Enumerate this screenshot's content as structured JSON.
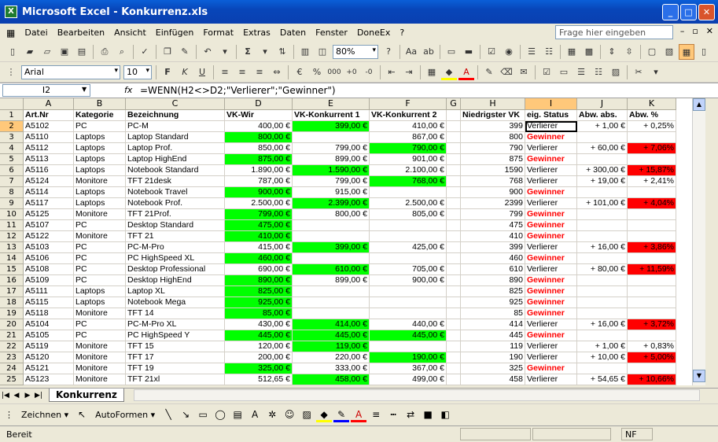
{
  "window": {
    "title": "Microsoft Excel - Konkurrenz.xls"
  },
  "menu": [
    "Datei",
    "Bearbeiten",
    "Ansicht",
    "Einfügen",
    "Format",
    "Extras",
    "Daten",
    "Fenster",
    "DoneEx",
    "?"
  ],
  "help_placeholder": "Frage hier eingeben",
  "toolbar": {
    "zoom": "80%",
    "font": "Arial",
    "size": "10",
    "bold": "F",
    "italic": "K",
    "underline": "U",
    "percent": "%",
    "thousands": "000"
  },
  "formula_bar": {
    "name_box": "I2",
    "fx": "fx",
    "formula": "=WENN(H2<>D2;\"Verlierer\";\"Gewinner\")"
  },
  "columns": [
    "A",
    "B",
    "C",
    "D",
    "E",
    "F",
    "G",
    "H",
    "I",
    "J",
    "K"
  ],
  "selected_column": "I",
  "header_row": [
    "Art.Nr",
    "Kategorie",
    "Bezeichnung",
    "VK-Wir",
    "VK-Konkurrent 1",
    "VK-Konkurrent 2",
    "",
    "Niedrigster VK",
    "eig. Status",
    "Abw. abs.",
    "Abw. %"
  ],
  "rows": [
    [
      "A5102",
      "PC",
      "PC-M",
      "400,00 €",
      "399,00 €",
      "410,00 €",
      "",
      "399",
      "Verlierer",
      "+ 1,00 €",
      "+ 0,25%"
    ],
    [
      "A5110",
      "Laptops",
      "Laptop Standard",
      "800,00 €",
      "",
      "867,00 €",
      "",
      "800",
      "Gewinner",
      "",
      ""
    ],
    [
      "A5112",
      "Laptops",
      "Laptop Prof.",
      "850,00 €",
      "799,00 €",
      "790,00 €",
      "",
      "790",
      "Verlierer",
      "+ 60,00 €",
      "+ 7,06%"
    ],
    [
      "A5113",
      "Laptops",
      "Laptop HighEnd",
      "875,00 €",
      "899,00 €",
      "901,00 €",
      "",
      "875",
      "Gewinner",
      "",
      ""
    ],
    [
      "A5116",
      "Laptops",
      "Notebook Standard",
      "1.890,00 €",
      "1.590,00 €",
      "2.100,00 €",
      "",
      "1590",
      "Verlierer",
      "+ 300,00 €",
      "+ 15,87%"
    ],
    [
      "A5124",
      "Monitore",
      "TFT 21desk",
      "787,00 €",
      "799,00 €",
      "768,00 €",
      "",
      "768",
      "Verlierer",
      "+ 19,00 €",
      "+ 2,41%"
    ],
    [
      "A5114",
      "Laptops",
      "Notebook Travel",
      "900,00 €",
      "915,00 €",
      "",
      "",
      "900",
      "Gewinner",
      "",
      ""
    ],
    [
      "A5117",
      "Laptops",
      "Notebook Prof.",
      "2.500,00 €",
      "2.399,00 €",
      "2.500,00 €",
      "",
      "2399",
      "Verlierer",
      "+ 101,00 €",
      "+ 4,04%"
    ],
    [
      "A5125",
      "Monitore",
      "TFT 21Prof.",
      "799,00 €",
      "800,00 €",
      "805,00 €",
      "",
      "799",
      "Gewinner",
      "",
      ""
    ],
    [
      "A5107",
      "PC",
      "Desktop Standard",
      "475,00 €",
      "",
      "",
      "",
      "475",
      "Gewinner",
      "",
      ""
    ],
    [
      "A5122",
      "Monitore",
      "TFT 21",
      "410,00 €",
      "",
      "",
      "",
      "410",
      "Gewinner",
      "",
      ""
    ],
    [
      "A5103",
      "PC",
      "PC-M-Pro",
      "415,00 €",
      "399,00 €",
      "425,00 €",
      "",
      "399",
      "Verlierer",
      "+ 16,00 €",
      "+ 3,86%"
    ],
    [
      "A5106",
      "PC",
      "PC HighSpeed XL",
      "460,00 €",
      "",
      "",
      "",
      "460",
      "Gewinner",
      "",
      ""
    ],
    [
      "A5108",
      "PC",
      "Desktop Professional",
      "690,00 €",
      "610,00 €",
      "705,00 €",
      "",
      "610",
      "Verlierer",
      "+ 80,00 €",
      "+ 11,59%"
    ],
    [
      "A5109",
      "PC",
      "Desktop HighEnd",
      "890,00 €",
      "899,00 €",
      "900,00 €",
      "",
      "890",
      "Gewinner",
      "",
      ""
    ],
    [
      "A5111",
      "Laptops",
      "Laptop XL",
      "825,00 €",
      "",
      "",
      "",
      "825",
      "Gewinner",
      "",
      ""
    ],
    [
      "A5115",
      "Laptops",
      "Notebook Mega",
      "925,00 €",
      "",
      "",
      "",
      "925",
      "Gewinner",
      "",
      ""
    ],
    [
      "A5118",
      "Monitore",
      "TFT 14",
      "85,00 €",
      "",
      "",
      "",
      "85",
      "Gewinner",
      "",
      ""
    ],
    [
      "A5104",
      "PC",
      "PC-M-Pro XL",
      "430,00 €",
      "414,00 €",
      "440,00 €",
      "",
      "414",
      "Verlierer",
      "+ 16,00 €",
      "+ 3,72%"
    ],
    [
      "A5105",
      "PC",
      "PC HighSpeed Y",
      "445,00 €",
      "445,00 €",
      "445,00 €",
      "",
      "445",
      "Gewinner",
      "",
      ""
    ],
    [
      "A5119",
      "Monitore",
      "TFT 15",
      "120,00 €",
      "119,00 €",
      "",
      "",
      "119",
      "Verlierer",
      "+ 1,00 €",
      "+ 0,83%"
    ],
    [
      "A5120",
      "Monitore",
      "TFT 17",
      "200,00 €",
      "220,00 €",
      "190,00 €",
      "",
      "190",
      "Verlierer",
      "+ 10,00 €",
      "+ 5,00%"
    ],
    [
      "A5121",
      "Monitore",
      "TFT 19",
      "325,00 €",
      "333,00 €",
      "367,00 €",
      "",
      "325",
      "Gewinner",
      "",
      ""
    ],
    [
      "A5123",
      "Monitore",
      "TFT 21xl",
      "512,65 €",
      "458,00 €",
      "499,00 €",
      "",
      "458",
      "Verlierer",
      "+ 54,65 €",
      "+ 10,66%"
    ]
  ],
  "green_cells": [
    [
      0,
      4
    ],
    [
      1,
      3
    ],
    [
      2,
      5
    ],
    [
      3,
      3
    ],
    [
      4,
      4
    ],
    [
      5,
      5
    ],
    [
      6,
      3
    ],
    [
      7,
      4
    ],
    [
      8,
      3
    ],
    [
      9,
      3
    ],
    [
      10,
      3
    ],
    [
      11,
      4
    ],
    [
      12,
      3
    ],
    [
      13,
      4
    ],
    [
      14,
      3
    ],
    [
      15,
      3
    ],
    [
      16,
      3
    ],
    [
      17,
      3
    ],
    [
      18,
      4
    ],
    [
      19,
      3
    ],
    [
      19,
      4
    ],
    [
      19,
      5
    ],
    [
      20,
      4
    ],
    [
      21,
      5
    ],
    [
      22,
      3
    ],
    [
      23,
      4
    ]
  ],
  "red_cells": [
    [
      2,
      10
    ],
    [
      4,
      10
    ],
    [
      7,
      10
    ],
    [
      11,
      10
    ],
    [
      13,
      10
    ],
    [
      18,
      10
    ],
    [
      21,
      10
    ],
    [
      23,
      10
    ]
  ],
  "sheet_tab": "Konkurrenz",
  "drawbar": {
    "zeichnen": "Zeichnen ▾",
    "autoformen": "AutoFormen ▾"
  },
  "status": {
    "ready": "Bereit",
    "nf": "NF"
  }
}
